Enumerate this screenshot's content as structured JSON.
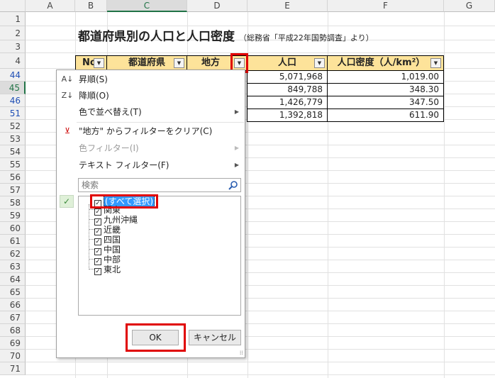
{
  "columns": [
    "A",
    "B",
    "C",
    "D",
    "E",
    "F",
    "G"
  ],
  "rows": [
    "1",
    "2",
    "3",
    "4",
    "44",
    "45",
    "46",
    "51",
    "52",
    "53",
    "54",
    "55",
    "56",
    "57",
    "58",
    "59",
    "60",
    "61",
    "62",
    "63",
    "64",
    "65",
    "66",
    "67",
    "68",
    "69",
    "70",
    "71"
  ],
  "title": "都道府県別の人口と人口密度",
  "subtitle": "（総務省「平成22年国勢調査」より）",
  "table": {
    "headers": [
      "No",
      "都道府県",
      "地方",
      "人口",
      "人口密度（人/km²）"
    ],
    "population": [
      "5,071,968",
      "849,788",
      "1,426,779",
      "1,392,818"
    ],
    "density": [
      "1,019.00",
      "348.30",
      "347.50",
      "611.90"
    ]
  },
  "menu": {
    "sort_asc": "昇順(S)",
    "sort_desc": "降順(O)",
    "sort_color": "色で並べ替え(T)",
    "clear_filter": "\"地方\" からフィルターをクリア(C)",
    "color_filter": "色フィルター(I)",
    "text_filter": "テキスト フィルター(F)",
    "search_placeholder": "検索",
    "items": [
      "(すべて選択)",
      "関東",
      "九州沖縄",
      "近畿",
      "四国",
      "中国",
      "中部",
      "東北"
    ],
    "ok": "OK",
    "cancel": "キャンセル"
  },
  "colors": {
    "header_fill": "#fde39a",
    "highlight": "#e00000",
    "select": "#3399ff"
  }
}
